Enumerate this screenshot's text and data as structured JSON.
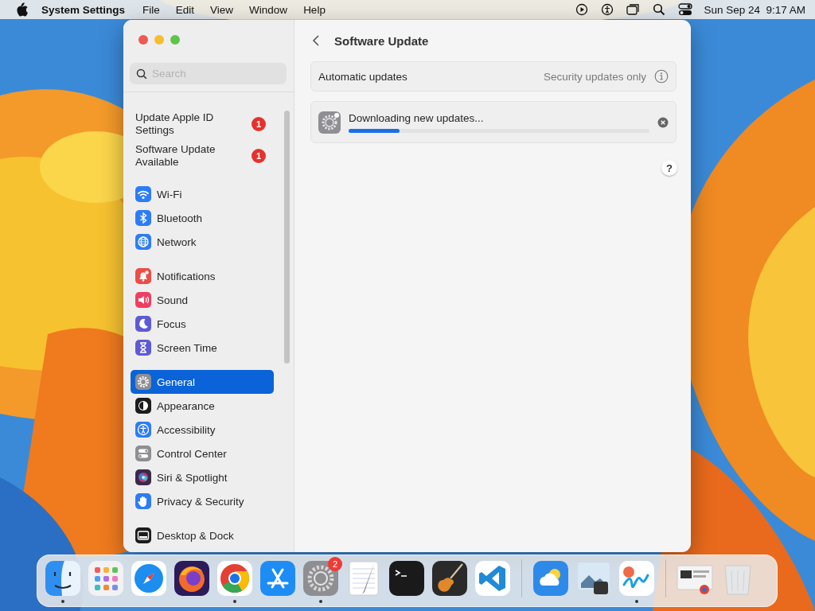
{
  "menubar": {
    "app_name": "System Settings",
    "menus": [
      "File",
      "Edit",
      "View",
      "Window",
      "Help"
    ],
    "clock": "Sun Sep 24  9:17 AM"
  },
  "window": {
    "search": {
      "placeholder": "Search"
    },
    "alerts": [
      {
        "label": "Update Apple ID Settings",
        "badge": "1"
      },
      {
        "label": "Software Update Available",
        "badge": "1"
      }
    ],
    "sidebar": {
      "groups": [
        {
          "items": [
            {
              "kind": "wifi",
              "label": "Wi-Fi",
              "color": "#2d7cf6",
              "selected": false
            },
            {
              "kind": "bluetooth",
              "label": "Bluetooth",
              "color": "#2d7cf6",
              "selected": false
            },
            {
              "kind": "network",
              "label": "Network",
              "color": "#2d7cf6",
              "selected": false
            }
          ]
        },
        {
          "items": [
            {
              "kind": "bell",
              "label": "Notifications",
              "color": "#ee4c47",
              "selected": false
            },
            {
              "kind": "sound",
              "label": "Sound",
              "color": "#ee3f63",
              "selected": false
            },
            {
              "kind": "moon",
              "label": "Focus",
              "color": "#5e5ad6",
              "selected": false
            },
            {
              "kind": "hourglass",
              "label": "Screen Time",
              "color": "#5e5ad6",
              "selected": false
            }
          ]
        },
        {
          "items": [
            {
              "kind": "gear",
              "label": "General",
              "color": "#8e8e93",
              "selected": true
            },
            {
              "kind": "appearance",
              "label": "Appearance",
              "color": "#1c1c1e",
              "selected": false
            },
            {
              "kind": "accessibility",
              "label": "Accessibility",
              "color": "#2d7cf6",
              "selected": false
            },
            {
              "kind": "toggles",
              "label": "Control Center",
              "color": "#8e8e93",
              "selected": false
            },
            {
              "kind": "siri",
              "label": "Siri & Spotlight",
              "color": "#3a2a4a",
              "selected": false
            },
            {
              "kind": "hand",
              "label": "Privacy & Security",
              "color": "#2d7cf6",
              "selected": false
            }
          ]
        },
        {
          "items": [
            {
              "kind": "dock",
              "label": "Desktop & Dock",
              "color": "#1c1c1e",
              "selected": false
            }
          ]
        }
      ]
    },
    "content": {
      "title": "Software Update",
      "automatic_updates": {
        "label": "Automatic updates",
        "value": "Security updates only"
      },
      "download": {
        "status": "Downloading new updates...",
        "level": 0.17
      },
      "help": "?"
    }
  },
  "dock": {
    "apps": [
      {
        "kind": "finder",
        "running": true
      },
      {
        "kind": "launchpad",
        "running": false
      },
      {
        "kind": "safari",
        "running": false
      },
      {
        "kind": "firefox",
        "running": false
      },
      {
        "kind": "chrome",
        "running": true
      },
      {
        "kind": "appstore",
        "running": false
      },
      {
        "kind": "settings",
        "running": true,
        "badge": "2"
      },
      {
        "kind": "textedit",
        "running": false
      },
      {
        "kind": "terminal",
        "running": false
      },
      {
        "kind": "guitar",
        "running": false
      },
      {
        "kind": "vscode",
        "running": false
      }
    ],
    "recent": [
      {
        "kind": "weather",
        "running": false
      },
      {
        "kind": "preview",
        "running": false
      },
      {
        "kind": "freeform",
        "running": true
      }
    ],
    "other": [
      {
        "kind": "thumbnail",
        "running": false
      },
      {
        "kind": "trash",
        "running": false
      }
    ]
  }
}
